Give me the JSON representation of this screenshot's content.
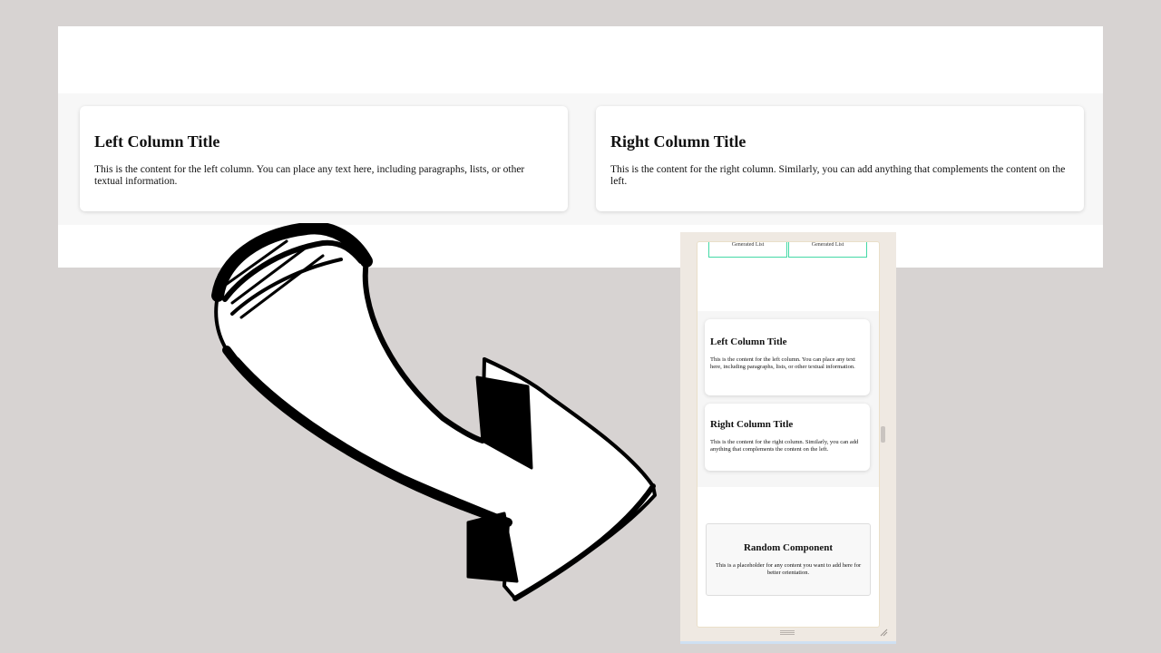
{
  "desktop": {
    "left_card": {
      "title": "Left Column Title",
      "body": "This is the content for the left column. You can place any text here, including paragraphs, lists, or other textual information."
    },
    "right_card": {
      "title": "Right Column Title",
      "body": "This is the content for the right column. Similarly, you can add anything that complements the content on the left."
    }
  },
  "mobile": {
    "generated_lists": [
      "Generated List",
      "Generated List"
    ],
    "left_card": {
      "title": "Left Column Title",
      "body": "This is the content for the left column. You can place any text here, including paragraphs, lists, or other textual information."
    },
    "right_card": {
      "title": "Right Column Title",
      "body": "This is the content for the right column. Similarly, you can add anything that complements the content on the left."
    },
    "random_component": {
      "title": "Random Component",
      "body": "This is a placeholder for any content you want to add here for better orientation."
    }
  },
  "colors": {
    "background": "#d7d3d2",
    "accent_border": "#44d9a6",
    "section_band": "#f7f7f7"
  },
  "icons": {
    "arrow": "curved-arrow-icon",
    "resize": "resize-grip-icon",
    "handle": "drag-handle-icon"
  }
}
